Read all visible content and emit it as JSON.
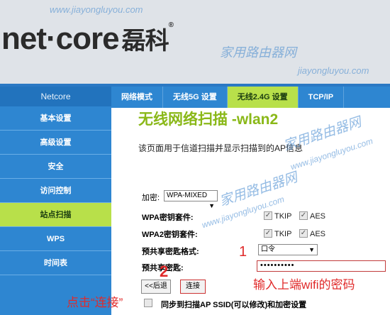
{
  "header": {
    "logo_text": "net·core",
    "logo_cn": "磊科",
    "logo_reg": "®",
    "watermarks": [
      "www.jiayongluyou.com",
      "家用路由器网",
      "jiayongluyou.com"
    ]
  },
  "sidebar": {
    "title": "Netcore",
    "items": [
      {
        "label": "基本设置",
        "active": false
      },
      {
        "label": "高级设置",
        "active": false
      },
      {
        "label": "安全",
        "active": false
      },
      {
        "label": "访问控制",
        "active": false
      },
      {
        "label": "站点扫描",
        "active": true
      },
      {
        "label": "WPS",
        "active": false
      },
      {
        "label": "时间表",
        "active": false
      }
    ]
  },
  "tabs": [
    {
      "label": "网络模式",
      "active": false
    },
    {
      "label": "无线5G 设置",
      "active": false
    },
    {
      "label": "无线2.4G 设置",
      "active": true
    },
    {
      "label": "TCP/IP",
      "active": false
    }
  ],
  "main": {
    "title": "无线网络扫描 -wlan2",
    "description": "该页面用于信道扫描并显示扫描到的AP信息",
    "encryption_label": "加密:",
    "encryption_value": "WPA-MIXED",
    "wpa_suite_label": "WPA密钥套件:",
    "wpa2_suite_label": "WPA2密钥套件:",
    "tkip_label": "TKIP",
    "aes_label": "AES",
    "psk_format_label": "预共享密匙格式:",
    "psk_format_value": "口令",
    "psk_label": "预共享密匙:",
    "psk_value": "••••••••••",
    "back_button": "<<后退",
    "connect_button": "连接",
    "sync_label": "同步到扫描AP SSID(可以修改)和加密设置"
  },
  "annotations": {
    "step1": "1",
    "step2": "2",
    "password_hint": "输入上端wifi的密码",
    "click_hint": "点击“连接”"
  },
  "colors": {
    "accent_blue": "#2e86d1",
    "active_green": "#b8e04a",
    "title_green": "#8ab818",
    "annotation_red": "#e02a2a"
  }
}
